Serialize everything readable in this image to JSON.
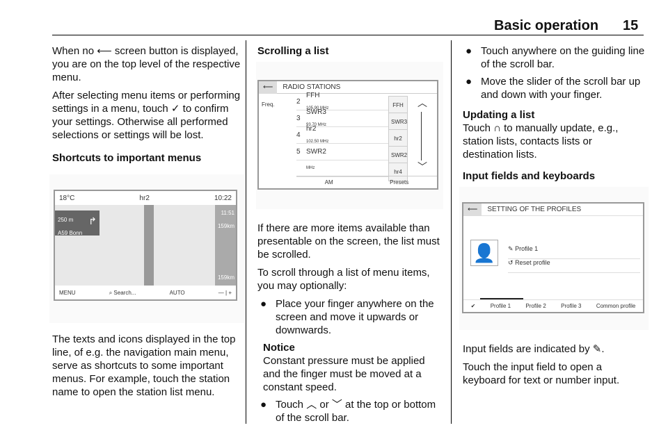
{
  "header": {
    "title": "Basic operation",
    "page": "15"
  },
  "col1": {
    "p1": "When no ⟵ screen button is displayed, you are on the top level of the respective menu.",
    "p2": "After selecting menu items or performing settings in a menu, touch ✓ to confirm your settings. Otherwise all performed selections or settings will be lost.",
    "h_shortcuts": "Shortcuts to important menus",
    "nav": {
      "temp": "18°C",
      "station": "hr2",
      "time": "10:22",
      "dist": "250 m",
      "road": "A59 Bonn",
      "eta": "11:51",
      "km_top": "159km",
      "km_bottom": "159km",
      "menu": "MENU",
      "search": "Search...",
      "auto": "AUTO"
    },
    "p3": "The texts and icons displayed in the top line, of e.g. the navigation main menu, serve as shortcuts to some important menus. For example, touch the station name to open the station list menu."
  },
  "col2": {
    "h_scroll": "Scrolling a list",
    "radio": {
      "title": "RADIO STATIONS",
      "freq": "Freq.",
      "stations": [
        {
          "num": "2",
          "name": "FFH",
          "mhz": "105.90 MHz",
          "btn": "FFH"
        },
        {
          "num": "3",
          "name": "SWR3",
          "mhz": "93.70 MHz",
          "btn": "SWR3"
        },
        {
          "num": "4",
          "name": "hr2",
          "mhz": "102.50 MHz",
          "btn": "hr2"
        },
        {
          "num": "5",
          "name": "SWR2",
          "mhz": "",
          "btn": "SWR2"
        },
        {
          "num": "",
          "name": "",
          "mhz": "MHz",
          "btn": "hr4"
        }
      ],
      "am": "AM",
      "presets": "Presets"
    },
    "p1": "If there are more items available than presentable on the screen, the list must be scrolled.",
    "p2": "To scroll through a list of menu items, you may optionally:",
    "b1": "Place your finger anywhere on the screen and move it upwards or downwards.",
    "notice_h": "Notice",
    "notice": "Constant pressure must be applied and the finger must be moved at a constant speed.",
    "b2": "Touch ︿ or ﹀ at the top or bottom of the scroll bar."
  },
  "col3": {
    "b1": "Touch anywhere on the guiding line of the scroll bar.",
    "b2": "Move the slider of the scroll bar up and down with your finger.",
    "h_update": "Updating a list",
    "p_update": "Touch ∩ to manually update, e.g., station lists, contacts lists or destination lists.",
    "h_input": "Input fields and keyboards",
    "profiles": {
      "title": "SETTING OF THE PROFILES",
      "name": "Profile 1",
      "reset": "Reset profile",
      "tabs": [
        "Profile 1",
        "Profile 2",
        "Profile 3",
        "Common profile"
      ]
    },
    "p1": "Input fields are indicated by ✎.",
    "p2": "Touch the input field to open a keyboard for text or number input."
  }
}
